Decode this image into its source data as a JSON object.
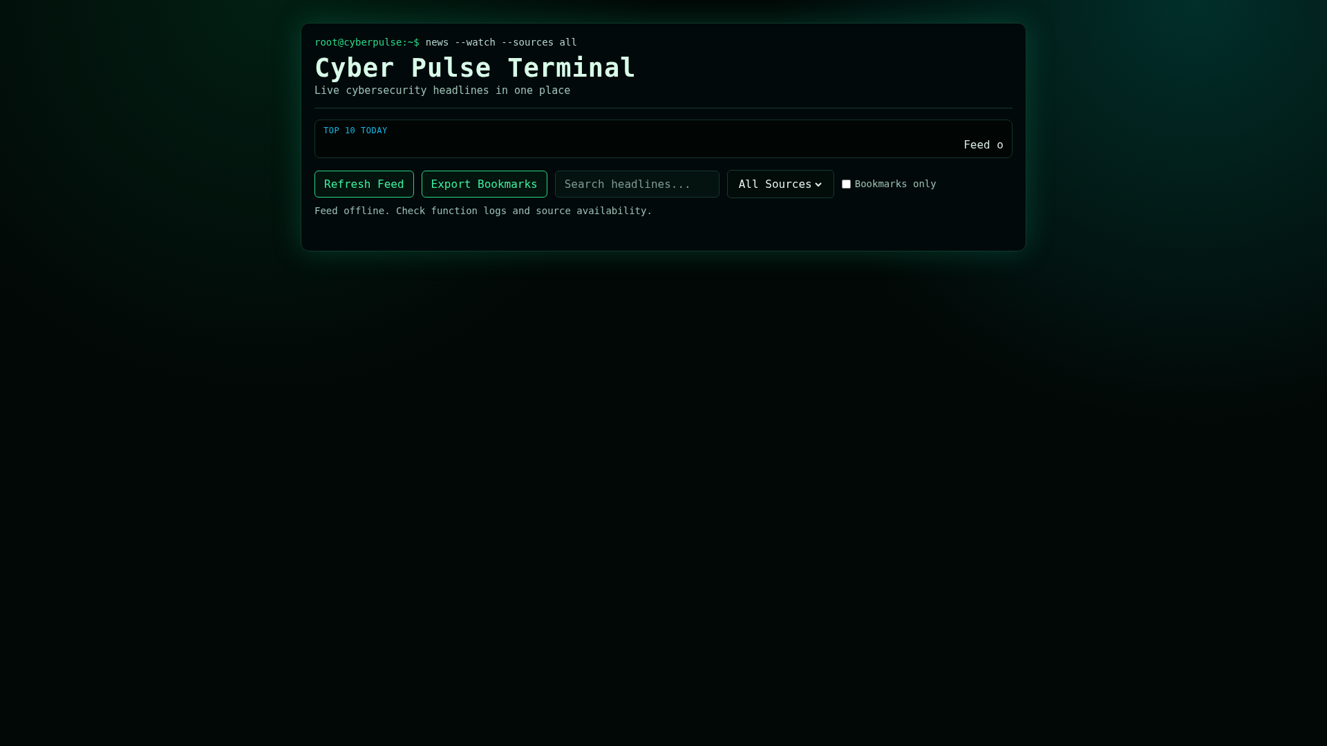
{
  "prompt": {
    "user": "root@cyberpulse:~$",
    "command": "news --watch --sources all"
  },
  "title": "Cyber Pulse Terminal",
  "subtitle": "Live cybersecurity headlines in one place",
  "ticker": {
    "label": "TOP 10 TODAY",
    "text": "Feed o"
  },
  "buttons": [
    "Refresh Feed",
    "Export Bookmarks"
  ],
  "search": {
    "placeholder": "Search headlines..."
  },
  "source_select": {
    "value": "All Sources"
  },
  "bookmarks_only": {
    "label": "Bookmarks only",
    "checked": false
  },
  "status": "Feed offline. Check function logs and source availability."
}
